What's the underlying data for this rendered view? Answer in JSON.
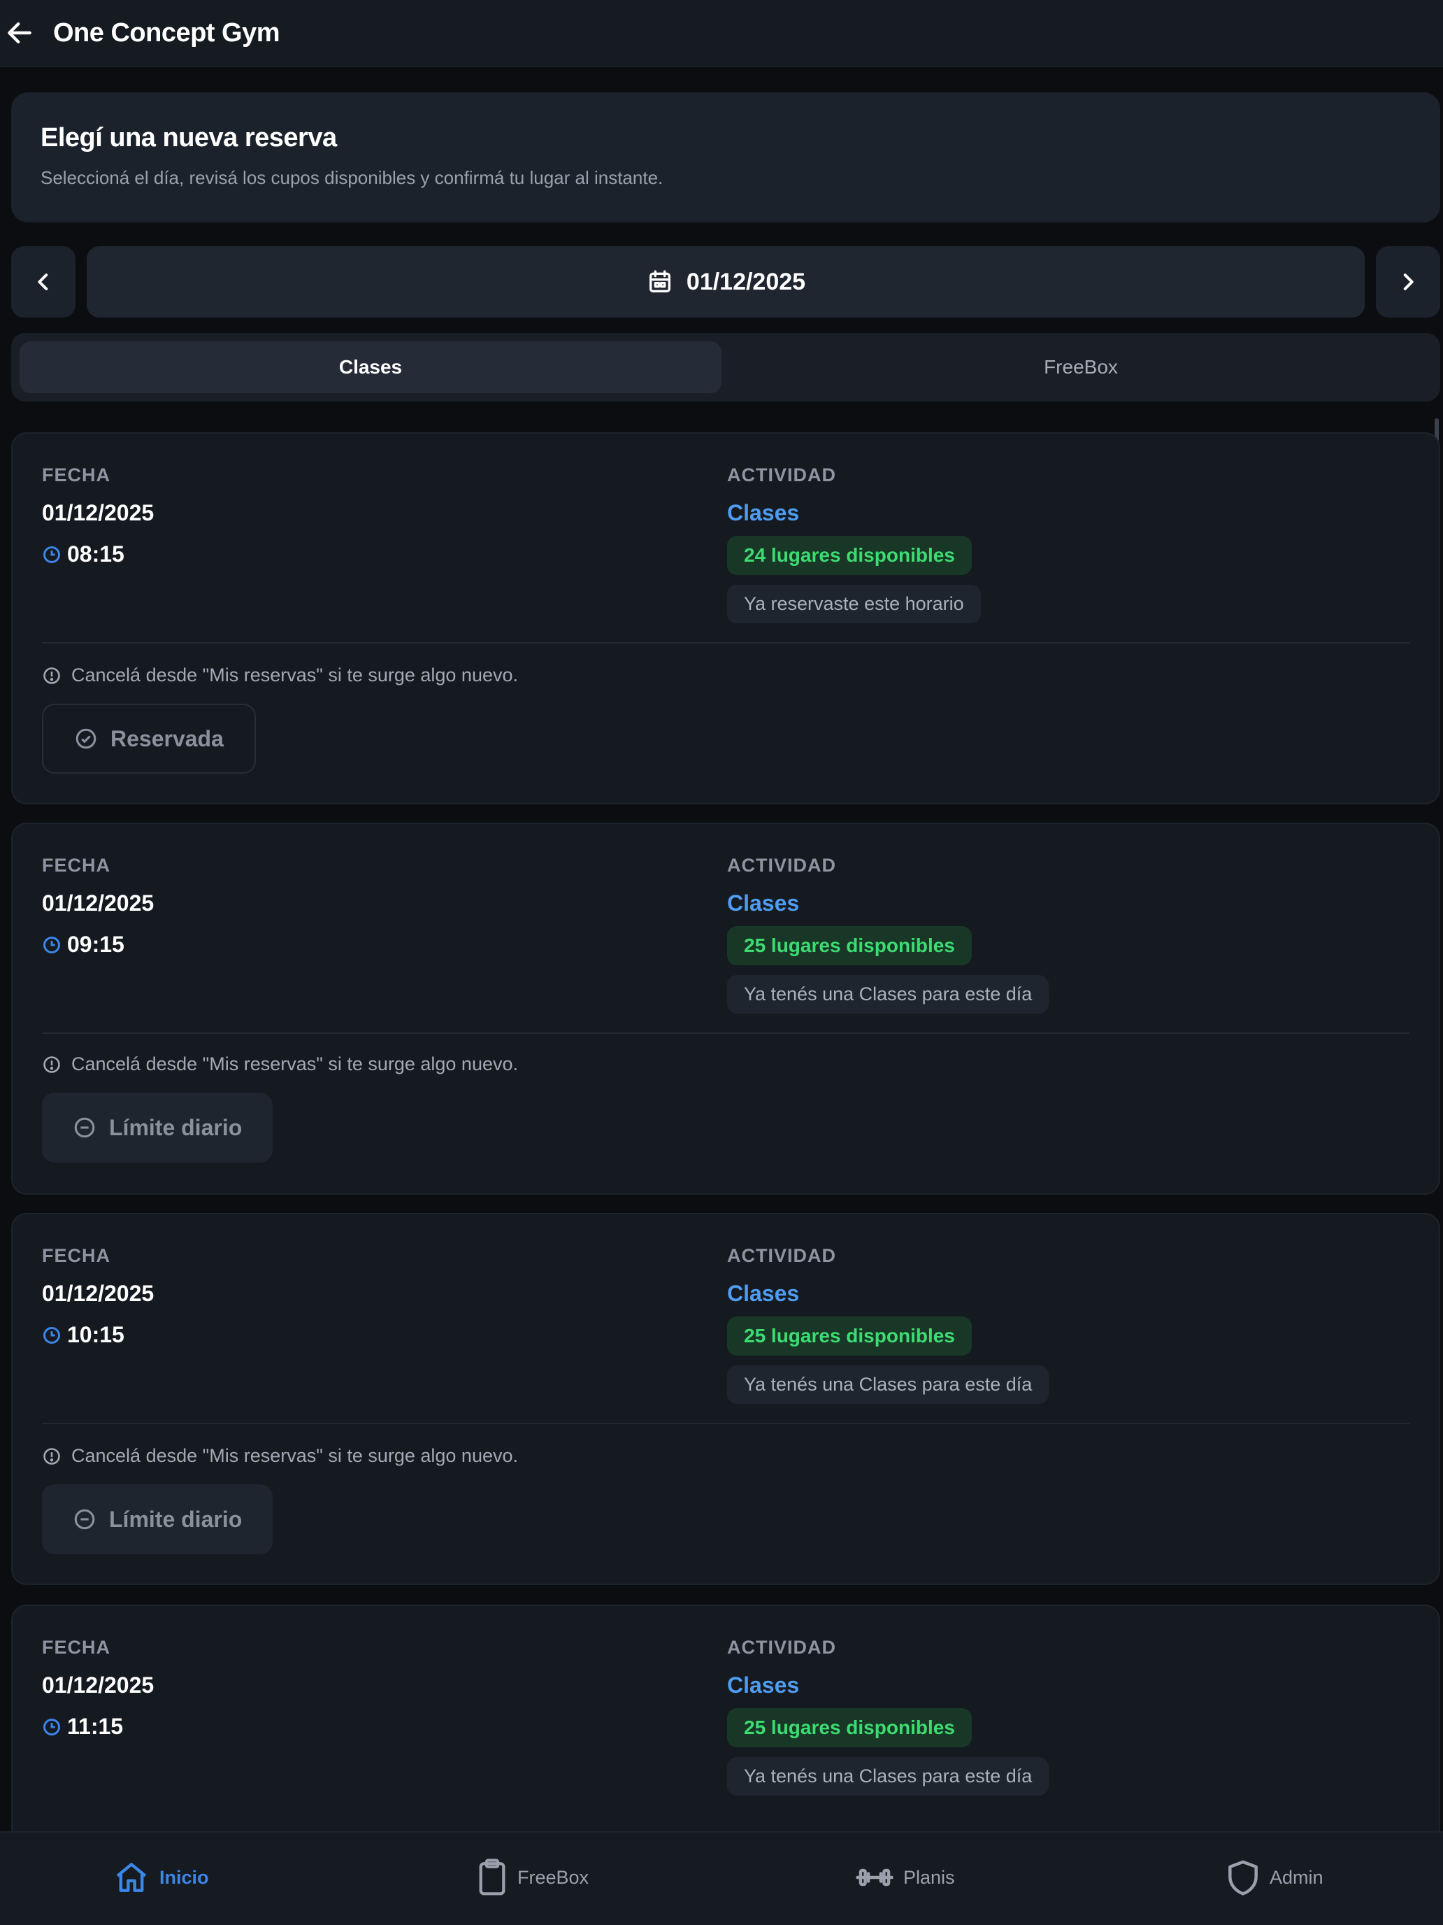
{
  "header": {
    "title": "One Concept Gym",
    "back_icon": "arrow-left-icon"
  },
  "intro": {
    "title": "Elegí una nueva reserva",
    "subtitle": "Seleccioná el día, revisá los cupos disponibles y confirmá tu lugar al instante."
  },
  "date_selector": {
    "selected_date": "01/12/2025",
    "calendar_icon": "calendar-icon",
    "prev_icon": "chevron-left-icon",
    "next_icon": "chevron-right-icon"
  },
  "tabs": [
    {
      "label": "Clases",
      "active": true
    },
    {
      "label": "FreeBox",
      "active": false
    }
  ],
  "labels": {
    "fecha": "FECHA",
    "actividad": "ACTIVIDAD"
  },
  "slots": [
    {
      "date": "01/12/2025",
      "time": "08:15",
      "activity": "Clases",
      "availability": "24 lugares disponibles",
      "status_note": "Ya reservaste este horario",
      "cancel_note": "Cancelá desde \"Mis reservas\" si te surge algo nuevo.",
      "action": "Reservada",
      "action_type": "reserved"
    },
    {
      "date": "01/12/2025",
      "time": "09:15",
      "activity": "Clases",
      "availability": "25 lugares disponibles",
      "status_note": "Ya tenés una Clases para este día",
      "cancel_note": "Cancelá desde \"Mis reservas\" si te surge algo nuevo.",
      "action": "Límite diario",
      "action_type": "limit"
    },
    {
      "date": "01/12/2025",
      "time": "10:15",
      "activity": "Clases",
      "availability": "25 lugares disponibles",
      "status_note": "Ya tenés una Clases para este día",
      "cancel_note": "Cancelá desde \"Mis reservas\" si te surge algo nuevo.",
      "action": "Límite diario",
      "action_type": "limit"
    },
    {
      "date": "01/12/2025",
      "time": "11:15",
      "activity": "Clases",
      "availability": "25 lugares disponibles",
      "status_note": "Ya tenés una Clases para este día"
    }
  ],
  "bottom_nav": [
    {
      "label": "Inicio",
      "icon": "home-icon",
      "active": true
    },
    {
      "label": "FreeBox",
      "icon": "clipboard-icon",
      "active": false
    },
    {
      "label": "Planis",
      "icon": "dumbbell-icon",
      "active": false
    },
    {
      "label": "Admin",
      "icon": "shield-icon",
      "active": false
    }
  ],
  "colors": {
    "accent": "#3b86e8",
    "activity": "#4f9cf0",
    "available": "#3ddc72",
    "background": "#0b0d11",
    "card": "#151a21"
  }
}
